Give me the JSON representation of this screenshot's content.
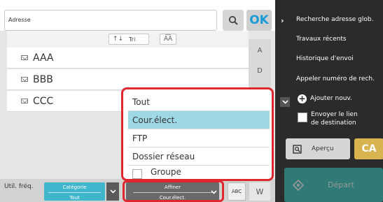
{
  "address": {
    "placeholder": "Adresse"
  },
  "toolbar": {
    "ok_label": "OK"
  },
  "sort": {
    "tri_label": "Tri",
    "aa_label": "A͞A"
  },
  "list": {
    "items": [
      {
        "label": "AAA"
      },
      {
        "label": "BBB"
      },
      {
        "label": "CCC"
      }
    ],
    "index_letters": [
      "A",
      "D"
    ]
  },
  "bottom": {
    "util_label": "Util. fréq.",
    "category_title": "Catégorie",
    "category_value": "Tout",
    "affiner_title": "Affiner",
    "affiner_value": "Cour.élect.",
    "abc_label": "ABC",
    "w_label": "W"
  },
  "dropdown": {
    "options": [
      "Tout",
      "Cour.élect.",
      "FTP",
      "Dossier réseau",
      "Groupe"
    ],
    "selected": "Cour.élect."
  },
  "side_menu": {
    "items": [
      "Recherche adresse glob.",
      "Travaux récents",
      "Historique d'envoi",
      "Appeler numéro de rech.",
      "Ajouter nouv."
    ],
    "envoyer_line1": "Envoyer le lien",
    "envoyer_line2": "de destination",
    "apercu_label": "Aperçu",
    "ca_label": "CA",
    "depart_label": "Départ"
  },
  "colors": {
    "accent": "#1a9bd7",
    "highlight": "#e0272f",
    "selected_row": "#9fd9e6",
    "start": "#2f7a76",
    "ca": "#d8b450"
  }
}
